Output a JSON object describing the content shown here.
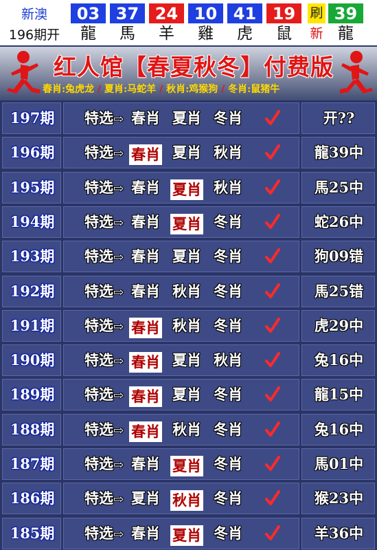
{
  "top_bar": {
    "lottery_name": "新澳",
    "draw_label": "196期开",
    "balls": [
      {
        "num": "03",
        "zodiac": "龍",
        "color": "#1f3fe0"
      },
      {
        "num": "37",
        "zodiac": "馬",
        "color": "#1f3fe0"
      },
      {
        "num": "24",
        "zodiac": "羊",
        "color": "#e41c1c"
      },
      {
        "num": "10",
        "zodiac": "雞",
        "color": "#1f3fe0"
      },
      {
        "num": "41",
        "zodiac": "虎",
        "color": "#1f3fe0"
      },
      {
        "num": "19",
        "zodiac": "鼠",
        "color": "#e41c1c"
      },
      {
        "num": "39",
        "zodiac": "龍",
        "color": "#18a838"
      }
    ],
    "refresh_top": "刷",
    "refresh_bottom": "新"
  },
  "banner": {
    "title": "红人馆【春夏秋冬】付费版",
    "subtitle_parts": [
      "春肖:兔虎龙",
      "夏肖:马蛇羊",
      "秋肖:鸡猴狗",
      "冬肖:鼠猪牛"
    ]
  },
  "table": {
    "pick_prefix": "特选",
    "rows": [
      {
        "issue": "197期",
        "picks": [
          "春肖",
          "夏肖",
          "冬肖"
        ],
        "hit": null,
        "result": "开??"
      },
      {
        "issue": "196期",
        "picks": [
          "春肖",
          "夏肖",
          "秋肖"
        ],
        "hit": 0,
        "result": "龍39中"
      },
      {
        "issue": "195期",
        "picks": [
          "春肖",
          "夏肖",
          "秋肖"
        ],
        "hit": 1,
        "result": "馬25中"
      },
      {
        "issue": "194期",
        "picks": [
          "春肖",
          "夏肖",
          "冬肖"
        ],
        "hit": 1,
        "result": "蛇26中"
      },
      {
        "issue": "193期",
        "picks": [
          "春肖",
          "夏肖",
          "冬肖"
        ],
        "hit": null,
        "result": "狗09错"
      },
      {
        "issue": "192期",
        "picks": [
          "春肖",
          "秋肖",
          "冬肖"
        ],
        "hit": null,
        "result": "馬25错"
      },
      {
        "issue": "191期",
        "picks": [
          "春肖",
          "秋肖",
          "冬肖"
        ],
        "hit": 0,
        "result": "虎29中"
      },
      {
        "issue": "190期",
        "picks": [
          "春肖",
          "夏肖",
          "秋肖"
        ],
        "hit": 0,
        "result": "兔16中"
      },
      {
        "issue": "189期",
        "picks": [
          "春肖",
          "夏肖",
          "冬肖"
        ],
        "hit": 0,
        "result": "龍15中"
      },
      {
        "issue": "188期",
        "picks": [
          "春肖",
          "秋肖",
          "冬肖"
        ],
        "hit": 0,
        "result": "兔16中"
      },
      {
        "issue": "187期",
        "picks": [
          "春肖",
          "夏肖",
          "冬肖"
        ],
        "hit": 1,
        "result": "馬01中"
      },
      {
        "issue": "186期",
        "picks": [
          "夏肖",
          "秋肖",
          "冬肖"
        ],
        "hit": 1,
        "result": "猴23中"
      },
      {
        "issue": "185期",
        "picks": [
          "春肖",
          "夏肖",
          "冬肖"
        ],
        "hit": 1,
        "result": "羊36中"
      }
    ]
  }
}
